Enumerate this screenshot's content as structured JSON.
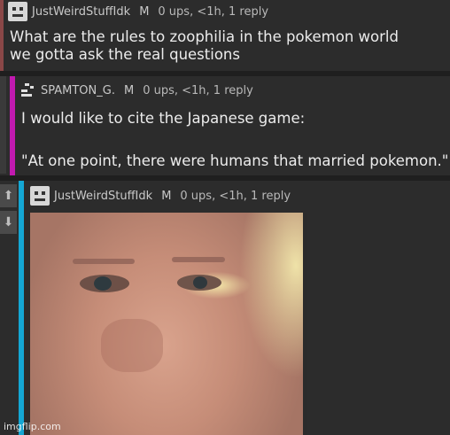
{
  "comments": [
    {
      "username": "JustWeirdStuffIdk",
      "flag": "M",
      "stats": "0 ups, <1h, 1 reply",
      "lines": [
        "What are the rules to zoophilia in the pokemon world",
        "we gotta ask the real questions"
      ]
    },
    {
      "username": "SPAMTON_G.",
      "flag": "M",
      "stats": "0 ups, <1h, 1 reply",
      "lines": [
        "I would like to cite the Japanese game:",
        "\"At one point, there were humans that married pokemon.\""
      ]
    },
    {
      "username": "JustWeirdStuffIdk",
      "flag": "M",
      "stats": "0 ups, <1h, 1 reply"
    }
  ],
  "watermark": "imgflip.com",
  "colors": {
    "bar1": "#8a4747",
    "bar2": "#c21ab0",
    "bar3": "#14a7d4"
  },
  "icons": {
    "upvote": "arrow-up-icon",
    "downvote": "arrow-down-icon"
  }
}
